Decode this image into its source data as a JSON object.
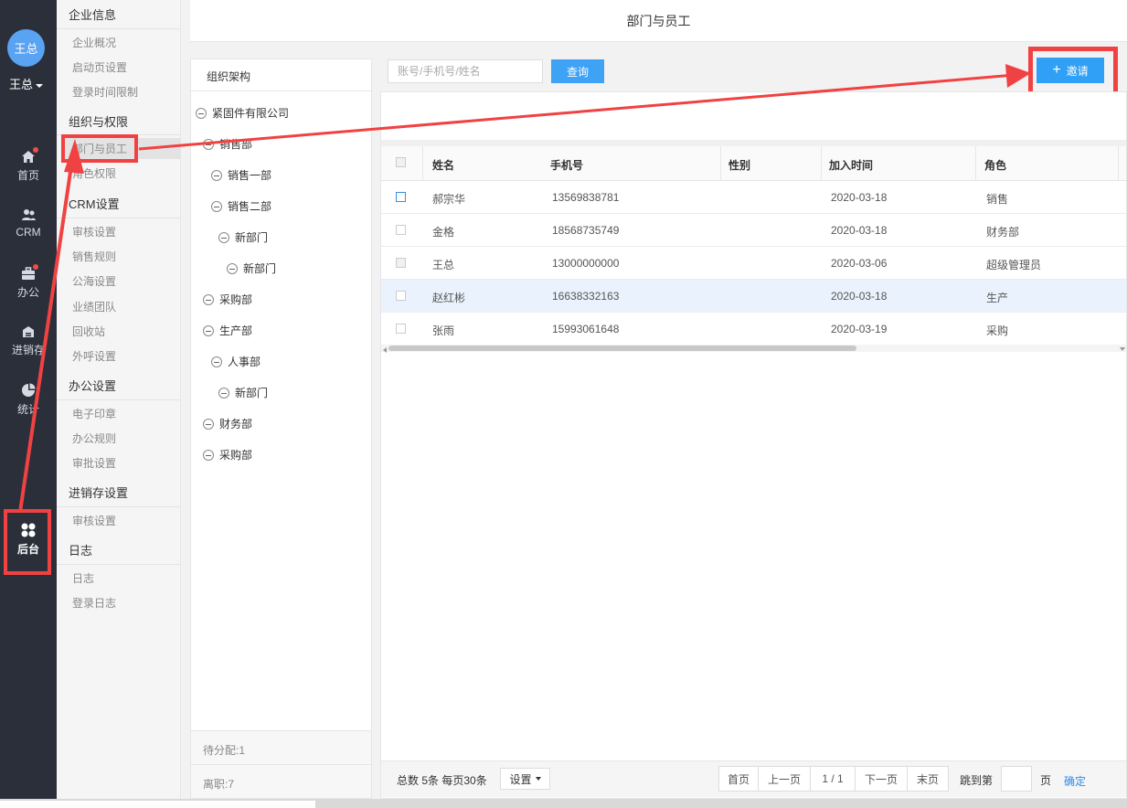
{
  "app": {
    "page_title": "部门与员工"
  },
  "user": {
    "avatar_text": "王总",
    "name": "王总"
  },
  "rail": [
    {
      "label": "首页",
      "icon": "home-icon",
      "dot": true
    },
    {
      "label": "CRM",
      "icon": "users-icon",
      "dot": false
    },
    {
      "label": "办公",
      "icon": "briefcase-icon",
      "dot": true
    },
    {
      "label": "进销存",
      "icon": "warehouse-icon",
      "dot": false
    },
    {
      "label": "统计",
      "icon": "pie-chart-icon",
      "dot": false
    },
    {
      "label": "后台",
      "icon": "grid-icon",
      "dot": false,
      "active": true
    }
  ],
  "submenu": {
    "groups": [
      {
        "title": "企业信息",
        "items": [
          "企业概况",
          "启动页设置",
          "登录时间限制"
        ]
      },
      {
        "title": "组织与权限",
        "items": [
          "部门与员工",
          "角色权限"
        ]
      },
      {
        "title": "CRM设置",
        "items": [
          "审核设置",
          "销售规则",
          "公海设置",
          "业绩团队",
          "回收站",
          "外呼设置"
        ]
      },
      {
        "title": "办公设置",
        "items": [
          "电子印章",
          "办公规则",
          "审批设置"
        ]
      },
      {
        "title": "进销存设置",
        "items": [
          "审核设置"
        ]
      },
      {
        "title": "日志",
        "items": [
          "日志",
          "登录日志"
        ]
      }
    ],
    "active_item": "部门与员工"
  },
  "org": {
    "header": "组织架构",
    "nodes": [
      {
        "label": "紧固件有限公司",
        "depth": 0
      },
      {
        "label": "销售部",
        "depth": 1
      },
      {
        "label": "销售一部",
        "depth": 2
      },
      {
        "label": "销售二部",
        "depth": 2
      },
      {
        "label": "新部门",
        "depth": 3
      },
      {
        "label": "新部门",
        "depth": 4
      },
      {
        "label": "采购部",
        "depth": 1
      },
      {
        "label": "生产部",
        "depth": 1
      },
      {
        "label": "人事部",
        "depth": 2
      },
      {
        "label": "新部门",
        "depth": 3
      },
      {
        "label": "财务部",
        "depth": 1
      },
      {
        "label": "采购部",
        "depth": 1
      }
    ],
    "unassigned": "待分配:1",
    "resigned": "离职:7"
  },
  "search": {
    "placeholder": "账号/手机号/姓名",
    "value": "",
    "query_label": "查询"
  },
  "invite": {
    "label": "邀请"
  },
  "table": {
    "columns": [
      "姓名",
      "手机号",
      "性别",
      "加入时间",
      "角色"
    ],
    "rows": [
      {
        "name": "郝宗华",
        "phone": "13569838781",
        "gender": "",
        "joined": "2020-03-18",
        "role": "销售"
      },
      {
        "name": "金格",
        "phone": "18568735749",
        "gender": "",
        "joined": "2020-03-18",
        "role": "财务部"
      },
      {
        "name": "王总",
        "phone": "13000000000",
        "gender": "",
        "joined": "2020-03-06",
        "role": "超级管理员"
      },
      {
        "name": "赵红彬",
        "phone": "16638332163",
        "gender": "",
        "joined": "2020-03-18",
        "role": "生产"
      },
      {
        "name": "张雨",
        "phone": "15993061648",
        "gender": "",
        "joined": "2020-03-19",
        "role": "采购"
      }
    ]
  },
  "pager": {
    "total": "总数 5条 每页30条",
    "settings": "设置",
    "first": "首页",
    "prev": "上一页",
    "current": "1 / 1",
    "next": "下一页",
    "last": "末页",
    "jump_label": "跳到第",
    "page_unit": "页",
    "confirm": "确定"
  },
  "colors": {
    "rail_bg": "#2b2f3a",
    "accent": "#3ea2f5",
    "annotation_red": "#f04242"
  }
}
